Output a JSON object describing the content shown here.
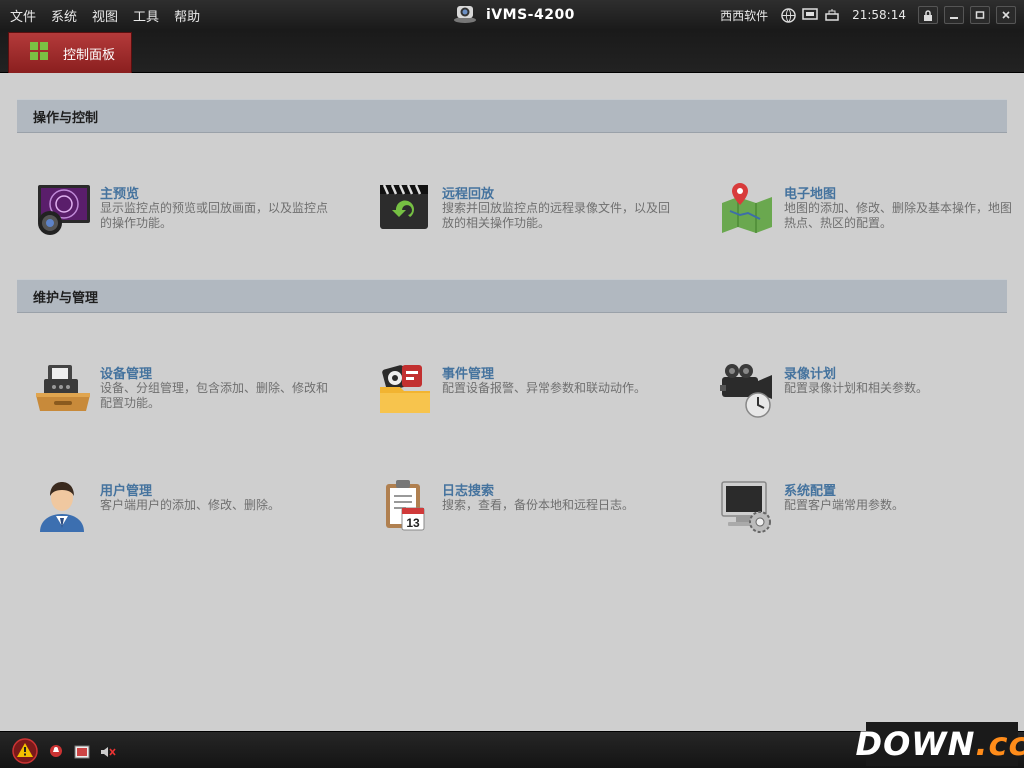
{
  "menu": {
    "file": "文件",
    "system": "系统",
    "view": "视图",
    "tools": "工具",
    "help": "帮助"
  },
  "app": {
    "title": "iVMS-4200",
    "user": "西西软件",
    "time": "21:58:14"
  },
  "tab": {
    "label": "控制面板"
  },
  "sections": {
    "operation": {
      "title": "操作与控制"
    },
    "maintenance": {
      "title": "维护与管理"
    }
  },
  "items": {
    "main_view": {
      "title": "主预览",
      "desc": "显示监控点的预览或回放画面，以及监控点的操作功能。"
    },
    "remote_playback": {
      "title": "远程回放",
      "desc": "搜索并回放监控点的远程录像文件，以及回放的相关操作功能。"
    },
    "emap": {
      "title": "电子地图",
      "desc": "地图的添加、修改、删除及基本操作，地图热点、热区的配置。"
    },
    "device_mgmt": {
      "title": "设备管理",
      "desc": "设备、分组管理，包含添加、删除、修改和配置功能。"
    },
    "event_mgmt": {
      "title": "事件管理",
      "desc": "配置设备报警、异常参数和联动动作。"
    },
    "record_schedule": {
      "title": "录像计划",
      "desc": "配置录像计划和相关参数。"
    },
    "user_mgmt": {
      "title": "用户管理",
      "desc": "客户端用户的添加、修改、删除。"
    },
    "log_search": {
      "title": "日志搜索",
      "desc": "搜索，查看，备份本地和远程日志。"
    },
    "sys_config": {
      "title": "系统配置",
      "desc": "配置客户端常用参数。"
    }
  },
  "watermark": {
    "main": "DOWN",
    "suffix": ".cc"
  },
  "calendar_day": "13"
}
